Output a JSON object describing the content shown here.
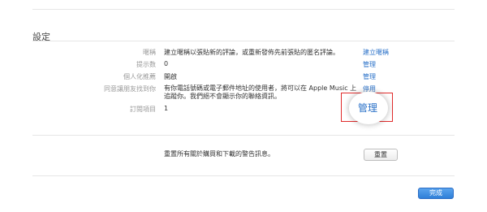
{
  "settings": {
    "section_title": "設定",
    "rows": [
      {
        "label": "暱稱",
        "value": "建立暱稱以張貼新的評論，或重新發佈先前張貼的匿名評論。",
        "action": "建立暱稱"
      },
      {
        "label": "提示数",
        "value": "0",
        "action": "管理"
      },
      {
        "label": "個人化推薦",
        "value": "開啟",
        "action": "管理"
      },
      {
        "label": "同意讓朋友找到你",
        "value": "有你電話號碼或電子郵件地址的使用者，將可以在 Apple Music 上追蹤你。我們絕不會顯示你的聯絡資訊。",
        "action": "停用"
      },
      {
        "label": "訂閱項目",
        "value": "1",
        "action": "管理"
      }
    ]
  },
  "footer": {
    "reset_text": "重置所有關於購買和下載的警告訊息。",
    "reset_button": "重置",
    "done_button": "完成"
  },
  "colors": {
    "link": "#2a71c8",
    "highlight": "#e02b2b",
    "done_button": "#3a86dc"
  }
}
